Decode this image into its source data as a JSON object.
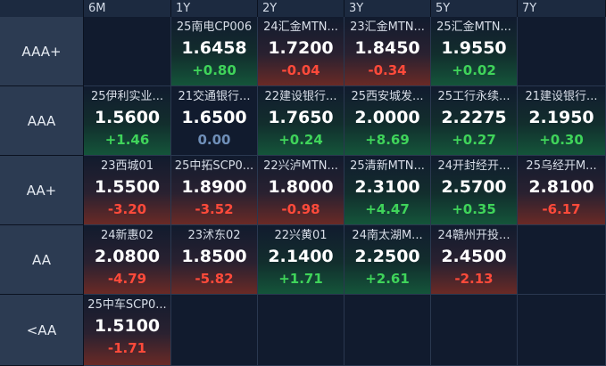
{
  "columns": [
    "6M",
    "1Y",
    "2Y",
    "3Y",
    "5Y",
    "7Y"
  ],
  "rows": [
    {
      "rating": "AAA+",
      "cells": [
        null,
        {
          "name": "25南电CP006",
          "value": "1.6458",
          "change": "+0.80",
          "trend": "up"
        },
        {
          "name": "24汇金MTN...",
          "value": "1.7200",
          "change": "-0.04",
          "trend": "down"
        },
        {
          "name": "23汇金MTN...",
          "value": "1.8450",
          "change": "-0.34",
          "trend": "down"
        },
        {
          "name": "25汇金MTN...",
          "value": "1.9550",
          "change": "+0.02",
          "trend": "up"
        },
        null
      ]
    },
    {
      "rating": "AAA",
      "cells": [
        {
          "name": "25伊利实业...",
          "value": "1.5600",
          "change": "+1.46",
          "trend": "up"
        },
        {
          "name": "21交通银行...",
          "value": "1.6500",
          "change": "0.00",
          "trend": "flat"
        },
        {
          "name": "22建设银行...",
          "value": "1.7650",
          "change": "+0.24",
          "trend": "up"
        },
        {
          "name": "25西安城发...",
          "value": "2.0000",
          "change": "+8.69",
          "trend": "up"
        },
        {
          "name": "25工行永续...",
          "value": "2.2275",
          "change": "+0.27",
          "trend": "up"
        },
        {
          "name": "21建设银行...",
          "value": "2.1950",
          "change": "+0.30",
          "trend": "up"
        }
      ]
    },
    {
      "rating": "AA+",
      "cells": [
        {
          "name": "23西城01",
          "value": "1.5500",
          "change": "-3.20",
          "trend": "down"
        },
        {
          "name": "25中拓SCP0...",
          "value": "1.8900",
          "change": "-3.52",
          "trend": "down"
        },
        {
          "name": "22兴泸MTN...",
          "value": "1.8000",
          "change": "-0.98",
          "trend": "down"
        },
        {
          "name": "25清新MTN...",
          "value": "2.3100",
          "change": "+4.47",
          "trend": "up"
        },
        {
          "name": "24开封经开...",
          "value": "2.5700",
          "change": "+0.35",
          "trend": "up"
        },
        {
          "name": "25乌经开M...",
          "value": "2.8100",
          "change": "-6.17",
          "trend": "down"
        }
      ]
    },
    {
      "rating": "AA",
      "cells": [
        {
          "name": "24新惠02",
          "value": "2.0800",
          "change": "-4.79",
          "trend": "down"
        },
        {
          "name": "23沭东02",
          "value": "1.8500",
          "change": "-5.82",
          "trend": "down"
        },
        {
          "name": "22兴黄01",
          "value": "2.1400",
          "change": "+1.71",
          "trend": "up"
        },
        {
          "name": "24南太湖M...",
          "value": "2.2500",
          "change": "+2.61",
          "trend": "up"
        },
        {
          "name": "24赣州开投...",
          "value": "2.4500",
          "change": "-2.13",
          "trend": "down"
        },
        null
      ]
    },
    {
      "rating": "<AA",
      "cells": [
        {
          "name": "25中车SCP0...",
          "value": "1.5100",
          "change": "-1.71",
          "trend": "down"
        },
        null,
        null,
        null,
        null,
        null
      ]
    }
  ]
}
